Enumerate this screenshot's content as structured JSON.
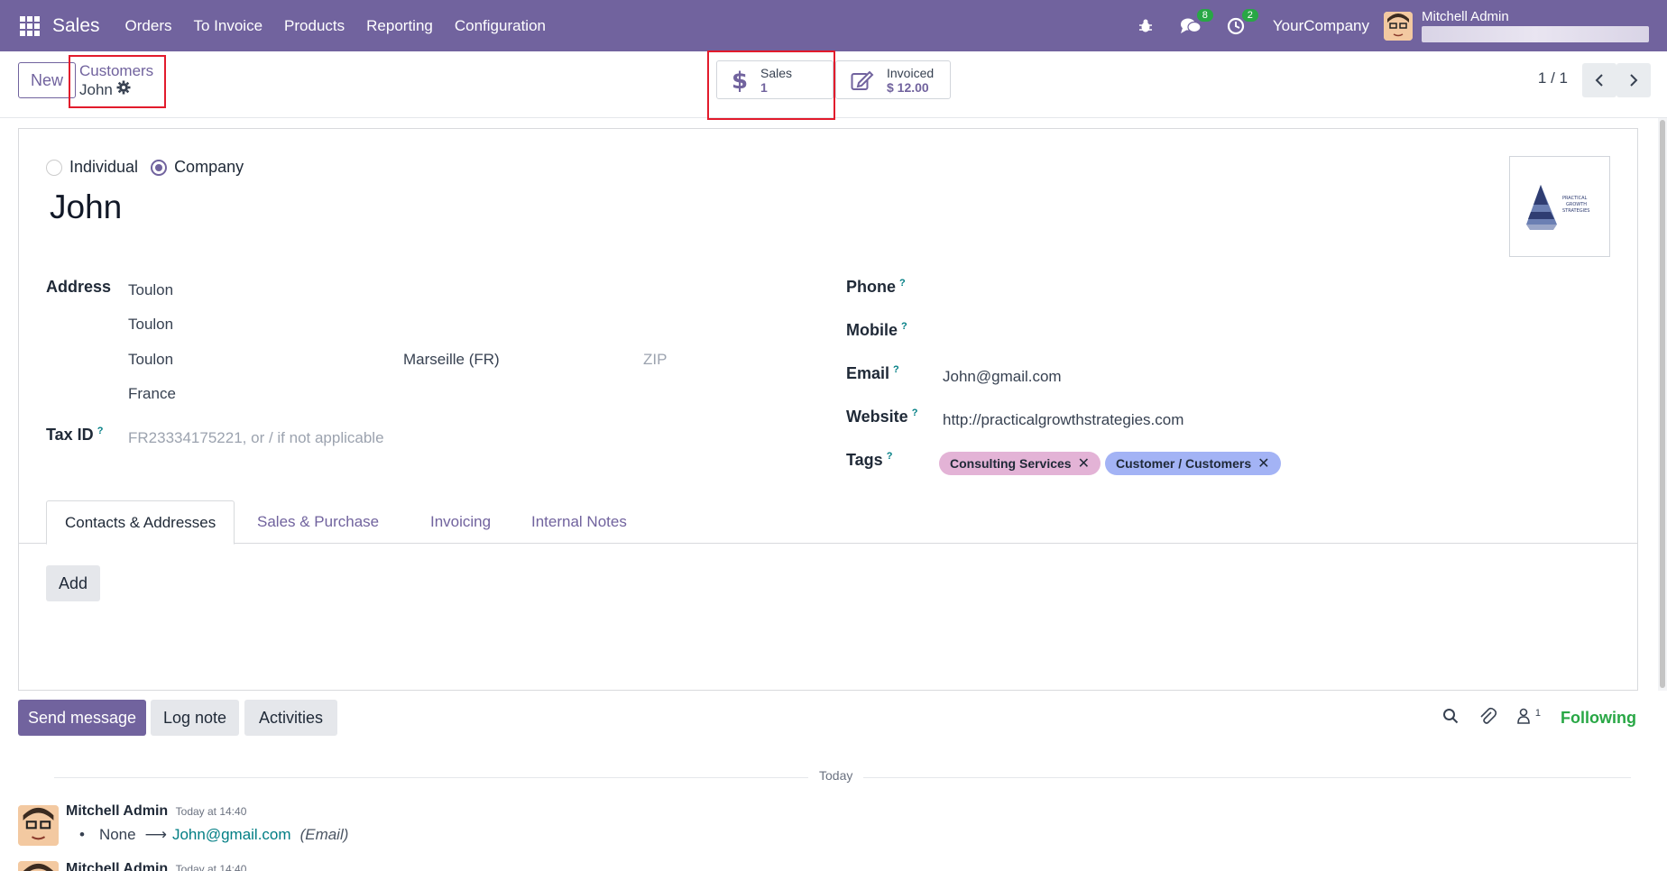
{
  "navbar": {
    "app_name": "Sales",
    "menu": [
      "Orders",
      "To Invoice",
      "Products",
      "Reporting",
      "Configuration"
    ],
    "messages_badge": "8",
    "activities_badge": "2",
    "company": "YourCompany",
    "user_name": "Mitchell Admin"
  },
  "control": {
    "new_label": "New",
    "breadcrumb_parent": "Customers",
    "breadcrumb_current": "John",
    "sales_label": "Sales",
    "sales_value": "1",
    "invoiced_label": "Invoiced",
    "invoiced_value": "$ 12.00",
    "pager": "1 / 1"
  },
  "form": {
    "type_individual": "Individual",
    "type_company": "Company",
    "name": "John",
    "labels": {
      "address": "Address",
      "tax_id": "Tax ID",
      "phone": "Phone",
      "mobile": "Mobile",
      "email": "Email",
      "website": "Website",
      "tags": "Tags"
    },
    "address": {
      "street": "Toulon",
      "street2": "Toulon",
      "city": "Toulon",
      "state": "Marseille (FR)",
      "zip_placeholder": "ZIP",
      "country": "France"
    },
    "tax_id_placeholder": "FR23334175221, or / if not applicable",
    "email": "John@gmail.com",
    "website": "http://practicalgrowthstrategies.com",
    "tags": [
      {
        "label": "Consulting Services",
        "color": "#e3b3d6"
      },
      {
        "label": "Customer / Customers",
        "color": "#a3b3f5"
      }
    ],
    "tabs": [
      "Contacts & Addresses",
      "Sales & Purchase",
      "Invoicing",
      "Internal Notes"
    ],
    "add_label": "Add"
  },
  "chatter": {
    "send_message": "Send message",
    "log_note": "Log note",
    "activities": "Activities",
    "followers_count": "1",
    "following": "Following",
    "day_label": "Today",
    "messages": [
      {
        "author": "Mitchell Admin",
        "time": "Today at 14:40",
        "old_value": "None",
        "new_value": "John@gmail.com",
        "field": "(Email)"
      },
      {
        "author": "Mitchell Admin",
        "time": "Today at 14:40"
      }
    ]
  },
  "colors": {
    "brand": "#71639e",
    "highlight": "#e21b2c",
    "link": "#017e84",
    "following": "#28a745"
  }
}
